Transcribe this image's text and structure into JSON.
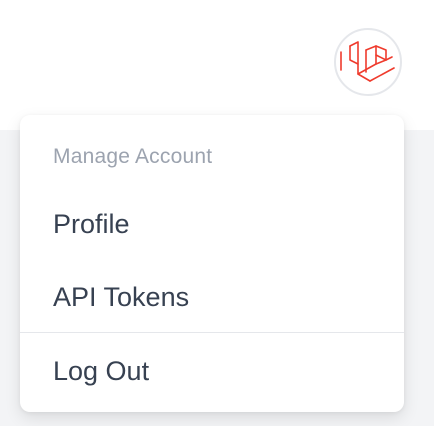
{
  "user": {
    "avatar_icon": "laravel-logo-icon"
  },
  "dropdown": {
    "header": "Manage Account",
    "items": [
      {
        "label": "Profile"
      },
      {
        "label": "API Tokens"
      },
      {
        "label": "Log Out"
      }
    ]
  },
  "colors": {
    "logo_red": "#ef3b2d",
    "header_gray": "#9ca3af",
    "item_text": "#374151",
    "divider": "#e5e7eb"
  }
}
